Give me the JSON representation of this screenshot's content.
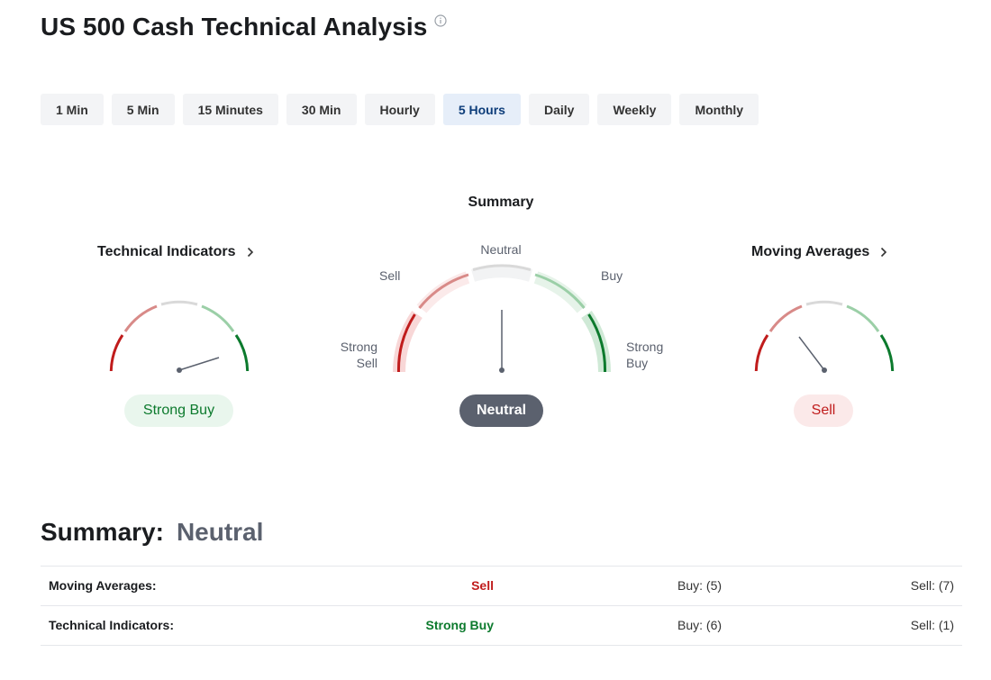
{
  "header": {
    "title": "US 500 Cash Technical Analysis",
    "info_icon": "info-icon"
  },
  "tabs": [
    {
      "label": "1 Min",
      "active": false
    },
    {
      "label": "5 Min",
      "active": false
    },
    {
      "label": "15 Minutes",
      "active": false
    },
    {
      "label": "30 Min",
      "active": false
    },
    {
      "label": "Hourly",
      "active": false
    },
    {
      "label": "5 Hours",
      "active": true
    },
    {
      "label": "Daily",
      "active": false
    },
    {
      "label": "Weekly",
      "active": false
    },
    {
      "label": "Monthly",
      "active": false
    }
  ],
  "summary_gauge": {
    "heading": "Summary",
    "labels": {
      "neutral": "Neutral",
      "sell": "Sell",
      "buy": "Buy",
      "strong_sell": "Strong Sell",
      "strong_buy": "Strong Buy"
    },
    "result": "Neutral"
  },
  "technical_indicators_gauge": {
    "title": "Technical Indicators",
    "result": "Strong Buy"
  },
  "moving_averages_gauge": {
    "title": "Moving Averages",
    "result": "Sell"
  },
  "summary_line": {
    "label": "Summary:",
    "value": "Neutral"
  },
  "table": {
    "rows": [
      {
        "name": "Moving Averages:",
        "status": "Sell",
        "buy": "Buy: (5)",
        "sell": "Sell: (7)"
      },
      {
        "name": "Technical Indicators:",
        "status": "Strong Buy",
        "buy": "Buy: (6)",
        "sell": "Sell: (1)"
      }
    ]
  },
  "colors": {
    "buy_green": "#0c7a2d",
    "sell_red": "#c01c1c",
    "neutral_gray": "#5b616e",
    "active_tab": "#0d3d7a"
  }
}
